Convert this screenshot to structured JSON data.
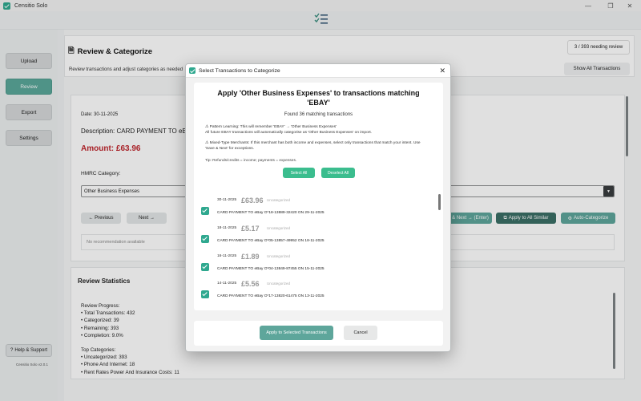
{
  "window": {
    "title": "Censitio Solo",
    "controls": [
      "—",
      "❐",
      "✕"
    ]
  },
  "sidebar": {
    "items": [
      {
        "label": "Upload",
        "active": false
      },
      {
        "label": "Review",
        "active": true
      },
      {
        "label": "Export",
        "active": false
      },
      {
        "label": "Settings",
        "active": false
      }
    ],
    "help_label": "Help & Support",
    "version": "Censitio Solo v2.0.1"
  },
  "review": {
    "title": "Review & Categorize",
    "subtitle": "Review transactions and adjust categories as needed",
    "needing_review": "3 / 393 needing review",
    "show_all_label": "Show All Transactions",
    "date": "Date: 30-11-2025",
    "description": "Description: CARD PAYMENT TO eBay O",
    "amount": "Amount: £63.96",
    "hmrc_label": "HMRC Category:",
    "category_value": "Other Business Expenses",
    "prev_label": "← Previous",
    "next_label": "Next →",
    "save_next_label": "& Next → (Enter)",
    "apply_all_label": "Apply to All Similar",
    "auto_label": "Auto-Categorize",
    "recommendation": "No recommendation available"
  },
  "stats": {
    "title": "Review Statistics",
    "lines": [
      "Review Progress:",
      "  • Total Transactions: 432",
      "  • Categorized: 39",
      "  • Remaining: 393",
      "  • Completion: 9.0%",
      "",
      "Top Categories:",
      "  • Uncategorized: 393",
      "  • Phone And Internet: 18",
      "  • Rent Rates Power And Insurance Costs: 11"
    ]
  },
  "dialog": {
    "title": "Select Transactions to Categorize",
    "heading": "Apply 'Other Business Expenses' to transactions matching 'EBAY'",
    "found": "Found 36 matching transactions",
    "pattern_line1": "⚠ Pattern Learning: This will remember 'EBAY' → 'Other Business Expenses'",
    "pattern_line2": "All future EBAY transactions will automatically categorise as 'Other Business Expenses' on import.",
    "mixed_line1": "⚠ Mixed-Type Merchants: If this merchant has both income and expenses, select only transactions that match your intent. Use",
    "mixed_line2": "'Save & Next' for exceptions.",
    "tip": "Tip: Refunds/credits = income; payments = expenses.",
    "select_all": "Select All",
    "deselect_all": "Deselect All",
    "transactions": [
      {
        "date": "30-11-2025",
        "amount": "£63.96",
        "category": "Uncategorized",
        "description": "CARD PAYMENT TO eBay O*18-13889-32420   ON 29-11-2025",
        "checked": true
      },
      {
        "date": "18-11-2025",
        "amount": "£5.17",
        "category": "Uncategorized",
        "description": "CARD PAYMENT TO eBay O*05-13857-49952 ON 18-11-2025",
        "checked": true
      },
      {
        "date": "16-11-2025",
        "amount": "£1.89",
        "category": "Uncategorized",
        "description": "CARD PAYMENT TO eBay O*04-13849-87455 ON 15-11-2025",
        "checked": true
      },
      {
        "date": "14-11-2025",
        "amount": "£5.56",
        "category": "Uncategorized",
        "description": "CARD PAYMENT TO eBay O*17-13820-61475 ON 13-11-2025",
        "checked": true
      }
    ],
    "apply_label": "Apply to Selected Transactions",
    "cancel_label": "Cancel"
  },
  "colors": {
    "accent": "#5ba89a",
    "amount_red": "#c0262d",
    "checkbox": "#2fa88f",
    "pill": "#3bbd8e"
  }
}
